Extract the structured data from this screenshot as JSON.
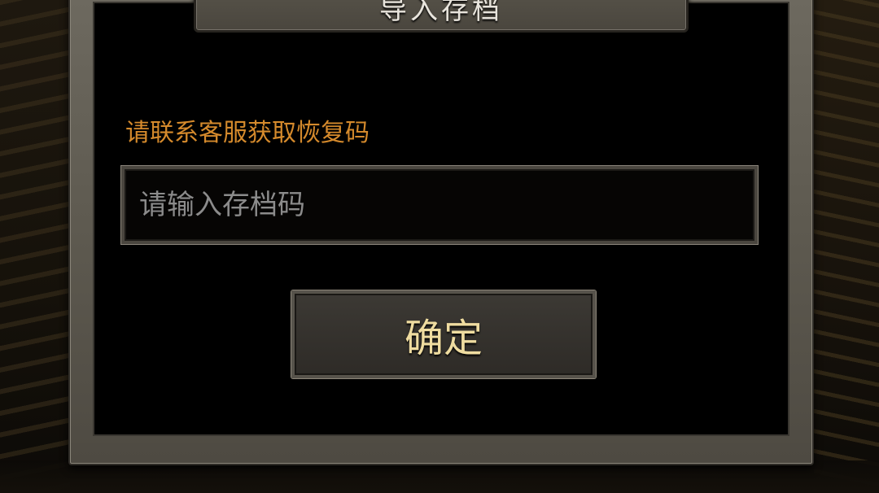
{
  "dialog": {
    "title": "导入存档",
    "hint": "请联系客服获取恢复码",
    "input_placeholder": "请输入存档码",
    "input_value": "",
    "confirm_label": "确定"
  },
  "colors": {
    "hint_text": "#d58a2c",
    "button_text": "#efdca0",
    "placeholder_text": "#8b8b8b",
    "frame": "#5e5a50",
    "panel": "#000000"
  }
}
